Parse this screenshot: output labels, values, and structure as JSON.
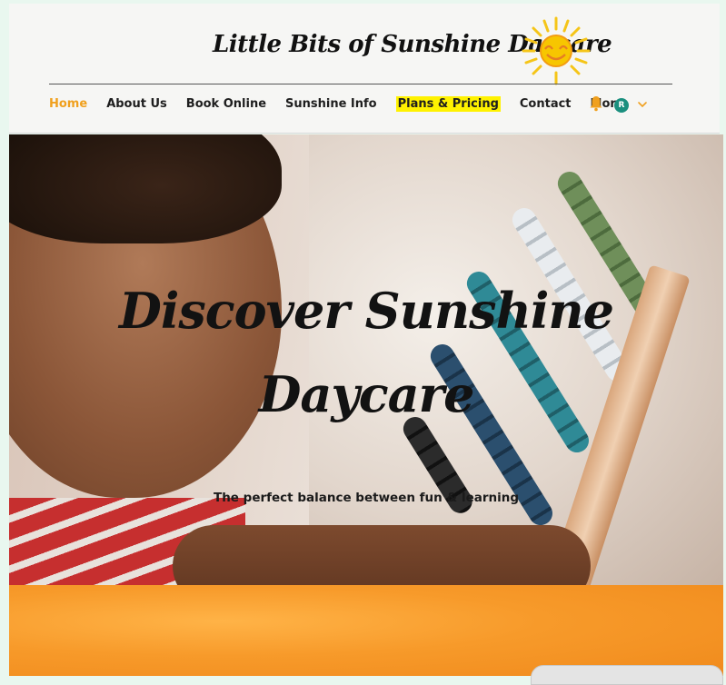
{
  "site": {
    "title": "Little Bits of Sunshine Daycare"
  },
  "nav": {
    "items": [
      {
        "label": "Home"
      },
      {
        "label": "About Us"
      },
      {
        "label": "Book Online"
      },
      {
        "label": "Sunshine Info"
      },
      {
        "label": "Plans & Pricing"
      },
      {
        "label": "Contact"
      },
      {
        "label": "More"
      }
    ],
    "active_color": "#f0a01e",
    "highlight_color": "#fff200"
  },
  "account": {
    "avatar_initial": "R",
    "avatar_color": "#1a8f7e",
    "notification_icon": "bell-icon",
    "menu_icon": "chevron-down-icon"
  },
  "hero": {
    "title_line1": "Discover Sunshine",
    "title_line2": "Daycare",
    "subtitle": "The perfect balance between fun & learning"
  }
}
